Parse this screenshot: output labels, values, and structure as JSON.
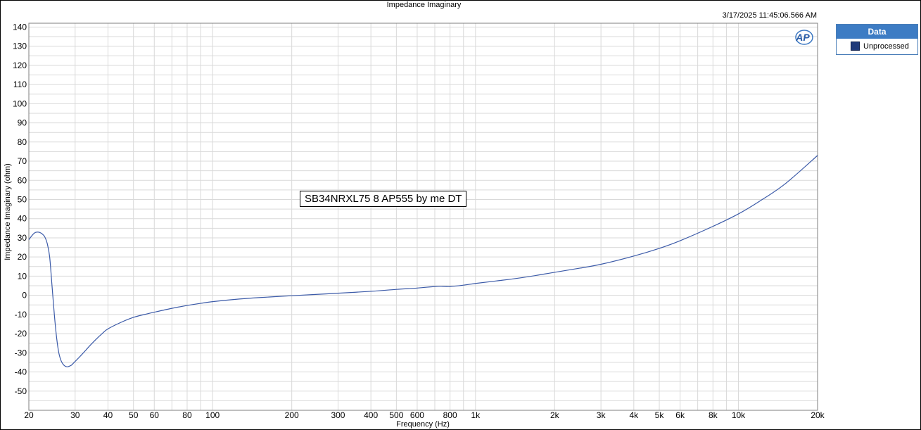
{
  "title": "Impedance Imaginary",
  "timestamp": "3/17/2025 11:45:06.566 AM",
  "annotation": "SB34NRXL75 8 AP555 by me DT",
  "legend": {
    "header": "Data",
    "items": [
      {
        "label": "Unprocessed",
        "color": "#1f3a7a"
      }
    ]
  },
  "logo_text": "AP",
  "chart_data": {
    "type": "line",
    "title": "Impedance Imaginary",
    "xlabel": "Frequency (Hz)",
    "ylabel": "Impedance Imaginary (ohm)",
    "xscale": "log",
    "xlim": [
      20,
      20000
    ],
    "ylim": [
      -60,
      142
    ],
    "grid": true,
    "x_ticks": [
      {
        "v": 20,
        "label": "20"
      },
      {
        "v": 30,
        "label": "30"
      },
      {
        "v": 40,
        "label": "40"
      },
      {
        "v": 50,
        "label": "50"
      },
      {
        "v": 60,
        "label": "60"
      },
      {
        "v": 80,
        "label": "80"
      },
      {
        "v": 100,
        "label": "100"
      },
      {
        "v": 200,
        "label": "200"
      },
      {
        "v": 300,
        "label": "300"
      },
      {
        "v": 400,
        "label": "400"
      },
      {
        "v": 500,
        "label": "500"
      },
      {
        "v": 600,
        "label": "600"
      },
      {
        "v": 800,
        "label": "800"
      },
      {
        "v": 1000,
        "label": "1k"
      },
      {
        "v": 2000,
        "label": "2k"
      },
      {
        "v": 3000,
        "label": "3k"
      },
      {
        "v": 4000,
        "label": "4k"
      },
      {
        "v": 5000,
        "label": "5k"
      },
      {
        "v": 6000,
        "label": "6k"
      },
      {
        "v": 8000,
        "label": "8k"
      },
      {
        "v": 10000,
        "label": "10k"
      },
      {
        "v": 20000,
        "label": "20k"
      }
    ],
    "y_ticks": [
      140,
      130,
      120,
      110,
      100,
      90,
      80,
      70,
      60,
      50,
      40,
      30,
      20,
      10,
      0,
      -10,
      -20,
      -30,
      -40,
      -50
    ],
    "series": [
      {
        "name": "Unprocessed",
        "color": "#3b5aa8",
        "x": [
          20,
          20.5,
          21,
          21.5,
          22,
          22.5,
          23,
          23.5,
          24,
          24.5,
          25,
          25.5,
          26,
          26.5,
          27,
          27.5,
          28,
          28.5,
          29,
          29.5,
          30,
          31,
          32,
          33,
          34,
          36,
          38,
          40,
          45,
          50,
          55,
          60,
          70,
          80,
          90,
          100,
          120,
          150,
          200,
          250,
          300,
          400,
          500,
          600,
          700,
          750,
          800,
          900,
          1000,
          1200,
          1500,
          2000,
          2500,
          3000,
          4000,
          5000,
          6000,
          8000,
          10000,
          12000,
          15000,
          20000
        ],
        "y": [
          29,
          31,
          32.5,
          33,
          32.8,
          32,
          30.5,
          27,
          20,
          5,
          -10,
          -22,
          -30,
          -34,
          -36,
          -37,
          -37.3,
          -37,
          -36.5,
          -35.5,
          -34.5,
          -32.5,
          -30.5,
          -28.5,
          -26.5,
          -23,
          -20,
          -17.5,
          -14,
          -11.5,
          -10,
          -8.8,
          -6.8,
          -5.3,
          -4.2,
          -3.3,
          -2.2,
          -1.2,
          -0.2,
          0.5,
          1.1,
          2.1,
          3.1,
          3.8,
          4.6,
          4.7,
          4.6,
          5.3,
          6.2,
          7.5,
          9.2,
          12,
          14.2,
          16.2,
          20.5,
          24.5,
          28.5,
          36,
          42.5,
          49,
          58,
          73
        ]
      }
    ]
  }
}
